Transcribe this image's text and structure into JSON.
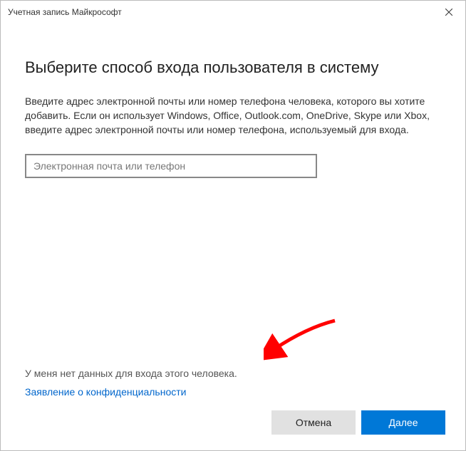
{
  "window": {
    "title": "Учетная запись Майкрософт"
  },
  "main": {
    "heading": "Выберите способ входа пользователя в систему",
    "description": "Введите адрес электронной почты или номер телефона человека, которого вы хотите добавить. Если он использует Windows, Office, Outlook.com, OneDrive, Skype или Xbox, введите адрес электронной почты или номер телефона, используемый для входа.",
    "email_placeholder": "Электронная почта или телефон",
    "email_value": ""
  },
  "links": {
    "no_login_info": "У меня нет данных для входа этого человека.",
    "privacy": "Заявление о конфиденциальности"
  },
  "buttons": {
    "cancel": "Отмена",
    "next": "Далее"
  },
  "colors": {
    "accent": "#0078d7",
    "link": "#0066cc"
  },
  "annotation": {
    "arrow_color": "#ff0000"
  }
}
